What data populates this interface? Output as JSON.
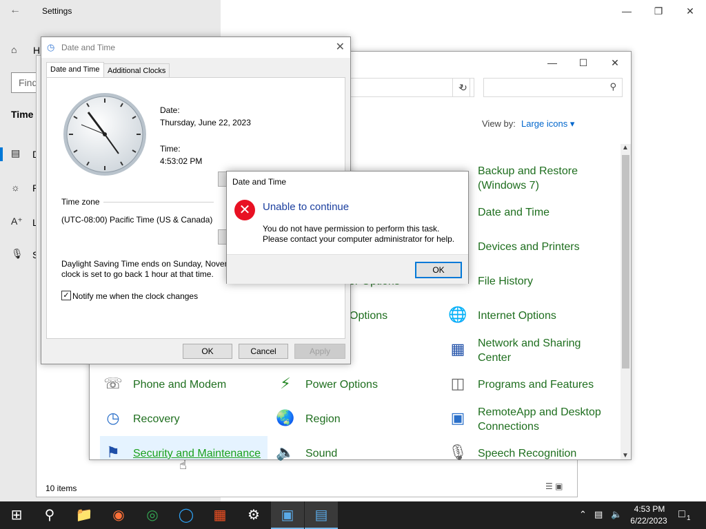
{
  "settings": {
    "title": "Settings",
    "home_label": "H",
    "find_placeholder": "Find",
    "section_label": "Time",
    "nav_letters": [
      "D",
      "R",
      "L",
      "S"
    ]
  },
  "control_panel": {
    "view_by_label": "View by:",
    "view_by_value": "Large icons",
    "status_items": "10 items",
    "items": [
      {
        "label": "Backup and Restore (Windows 7)",
        "icon": "backup-icon"
      },
      {
        "label": "Date and Time",
        "icon": "date-time-icon"
      },
      {
        "label": "Devices and Printers",
        "icon": "printer-icon"
      },
      {
        "label": "File History",
        "icon": "file-history-icon"
      },
      {
        "label": "Internet Options",
        "icon": "globe-icon"
      },
      {
        "label": "Network and Sharing Center",
        "icon": "network-icon"
      },
      {
        "label": "Phone and Modem",
        "icon": "phone-icon"
      },
      {
        "label": "Power Options",
        "icon": "battery-icon"
      },
      {
        "label": "Programs and Features",
        "icon": "programs-icon"
      },
      {
        "label": "Recovery",
        "icon": "recovery-icon"
      },
      {
        "label": "Region",
        "icon": "region-icon"
      },
      {
        "label": "RemoteApp and Desktop Connections",
        "icon": "remote-icon"
      },
      {
        "label": "Security and Maintenance",
        "icon": "flag-icon"
      },
      {
        "label": "Sound",
        "icon": "speaker-icon"
      },
      {
        "label": "Speech Recognition",
        "icon": "microphone-icon"
      }
    ],
    "partial_labels": [
      "ver Options",
      "Options"
    ]
  },
  "date_time_dialog": {
    "title": "Date and Time",
    "tabs": [
      "Date and Time",
      "Additional Clocks"
    ],
    "date_label": "Date:",
    "date_value": "Thursday, June 22, 2023",
    "time_label": "Time:",
    "time_value": "4:53:02 PM",
    "time_zone_label": "Time zone",
    "time_zone_value": "(UTC-08:00) Pacific Time (US & Canada)",
    "dst_text_1": "Daylight Saving Time ends on Sunday, Novem",
    "dst_text_2": "clock is set to go back 1 hour at that time.",
    "notify_label": "Notify me when the clock changes",
    "notify_checked": true,
    "buttons": {
      "ok": "OK",
      "cancel": "Cancel",
      "apply": "Apply"
    }
  },
  "error_dialog": {
    "title": "Date and Time",
    "heading": "Unable to continue",
    "message_1": "You do not have permission to perform this task.",
    "message_2": "Please contact your computer administrator for help.",
    "ok_label": "OK"
  },
  "taskbar": {
    "time": "4:53 PM",
    "date": "6/22/2023",
    "notification_count": "1",
    "apps": [
      "start-icon",
      "search-icon",
      "file-explorer-icon",
      "firefox-icon",
      "chrome-icon",
      "edge-icon",
      "store-icon",
      "settings-icon",
      "control-panel-icon",
      "date-time-app-icon"
    ]
  }
}
